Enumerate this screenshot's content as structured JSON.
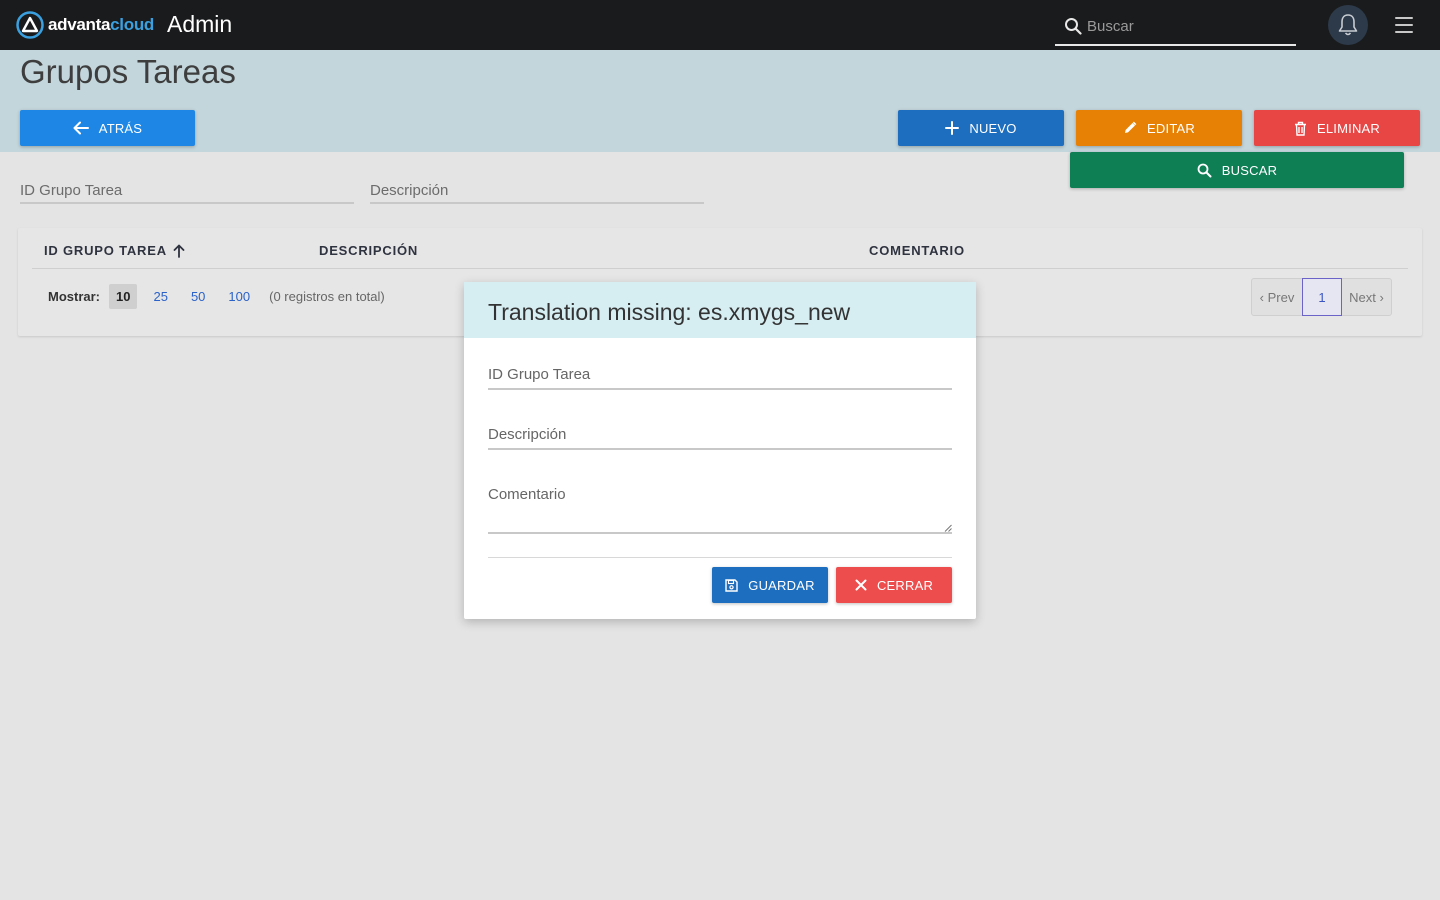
{
  "navbar": {
    "logo_text_main": "advanta",
    "logo_text_accent": "cloud",
    "app_title": "Admin",
    "search_placeholder": "Buscar"
  },
  "page": {
    "title": "Grupos Tareas"
  },
  "toolbar": {
    "back_label": "ATRÁS",
    "new_label": "NUEVO",
    "edit_label": "EDITAR",
    "delete_label": "ELIMINAR",
    "search_label": "BUSCAR"
  },
  "filters": {
    "id_placeholder": "ID Grupo Tarea",
    "desc_placeholder": "Descripción"
  },
  "table": {
    "columns": [
      "ID GRUPO TAREA",
      "DESCRIPCIÓN",
      "COMENTARIO"
    ],
    "show_label": "Mostrar:",
    "page_sizes": [
      "10",
      "25",
      "50",
      "100"
    ],
    "selected_page_size": "10",
    "total_text": "(0 registros en total)",
    "pager": {
      "prev": "‹ Prev",
      "current": "1",
      "next": "Next ›"
    }
  },
  "modal": {
    "title": "Translation missing: es.xmygs_new",
    "id_placeholder": "ID Grupo Tarea",
    "desc_placeholder": "Descripción",
    "comment_placeholder": "Comentario",
    "save_label": "GUARDAR",
    "close_label": "CERRAR"
  },
  "colors": {
    "navbar": "#1a1b1d",
    "header_band": "#c3d6db",
    "back": "#1e87e5",
    "new": "#1e6ebf",
    "edit": "#e68106",
    "delete": "#e84545",
    "search": "#0e7e55",
    "close": "#ee4d4d"
  }
}
